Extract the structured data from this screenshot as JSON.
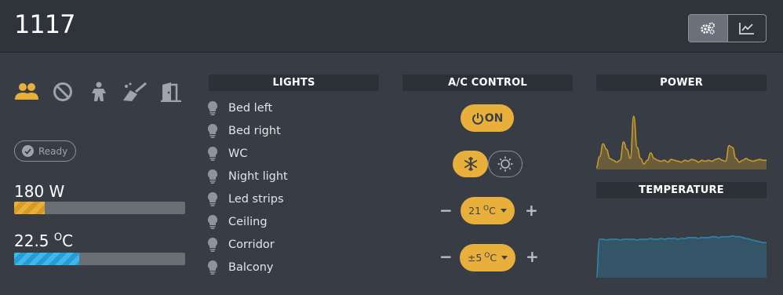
{
  "header": {
    "room": "1117",
    "view_buttons": [
      {
        "name": "settings",
        "icon": "gears-icon",
        "active": true
      },
      {
        "name": "charts",
        "icon": "line-chart-icon",
        "active": false
      }
    ]
  },
  "status": {
    "icons": [
      {
        "icon": "occupied-users-icon",
        "color": "#e8b03a"
      },
      {
        "icon": "do-not-disturb-icon",
        "color": "#9ea4ab"
      },
      {
        "icon": "person-icon",
        "color": "#9ea4ab"
      },
      {
        "icon": "cleaning-broom-icon",
        "color": "#9ea4ab"
      },
      {
        "icon": "door-icon",
        "color": "#9ea4ab"
      }
    ],
    "ready_label": "Ready"
  },
  "metrics": {
    "power": {
      "value": "180 W",
      "fraction": 0.18
    },
    "temperature": {
      "value": "22.5",
      "unit": "O",
      "unit_suffix": "C",
      "fraction": 0.38
    }
  },
  "lights": {
    "title": "LIGHTS",
    "items": [
      "Bed left",
      "Bed right",
      "WC",
      "Night light",
      "Led strips",
      "Ceiling",
      "Corridor",
      "Balcony"
    ]
  },
  "ac": {
    "title": "A/C CONTROL",
    "power_label": "ON",
    "setpoint": {
      "value": "21",
      "unit": "O",
      "unit_suffix": "C",
      "minus": "−",
      "plus": "+"
    },
    "offset": {
      "value": "±5",
      "unit": "O",
      "unit_suffix": "C",
      "minus": "−",
      "plus": "+"
    }
  },
  "charts": {
    "power_title": "POWER",
    "temperature_title": "TEMPERATURE"
  },
  "colors": {
    "accent": "#e8b03a",
    "power_bar": "#e8b03a",
    "temperature_bar": "#3fb7ea",
    "power_line": "#c99a2a",
    "temperature_line": "#2e84a8"
  },
  "chart_data": [
    {
      "type": "area",
      "name": "power",
      "x": [
        0,
        1,
        2,
        3,
        4,
        5,
        6,
        7,
        8,
        9,
        10,
        11,
        12,
        13,
        14,
        15,
        16,
        17,
        18,
        19,
        20,
        21,
        22,
        23,
        24,
        25,
        26,
        27,
        28,
        29,
        30,
        31,
        32,
        33,
        34,
        35,
        36,
        37,
        38,
        39,
        40,
        41,
        42,
        43,
        44,
        45,
        46,
        47,
        48,
        49,
        50
      ],
      "values": [
        2,
        14,
        28,
        22,
        12,
        10,
        8,
        10,
        30,
        22,
        12,
        58,
        24,
        12,
        6,
        10,
        18,
        12,
        10,
        9,
        10,
        8,
        11,
        10,
        9,
        8,
        10,
        9,
        11,
        10,
        8,
        10,
        9,
        10,
        9,
        11,
        12,
        10,
        9,
        26,
        24,
        12,
        8,
        10,
        12,
        10,
        9,
        10,
        11,
        10,
        10
      ],
      "ylim": [
        0,
        65
      ]
    },
    {
      "type": "area",
      "name": "temperature",
      "x": [
        0,
        1,
        2,
        3,
        4,
        5,
        6,
        7,
        8,
        9,
        10,
        11,
        12,
        13,
        14,
        15,
        16,
        17,
        18,
        19,
        20,
        21,
        22,
        23,
        24,
        25,
        26,
        27,
        28,
        29,
        30,
        31,
        32,
        33,
        34,
        35,
        36,
        37,
        38,
        39,
        40,
        41,
        42,
        43,
        44,
        45,
        46,
        47,
        48,
        49,
        50
      ],
      "values": [
        0,
        46,
        46,
        45,
        46,
        46,
        46,
        45,
        46,
        46,
        46,
        46,
        45,
        46,
        46,
        46,
        47,
        46,
        46,
        47,
        46,
        47,
        47,
        47,
        46,
        47,
        47,
        48,
        48,
        48,
        47,
        48,
        48,
        48,
        49,
        49,
        48,
        49,
        49,
        49,
        50,
        49,
        49,
        48,
        47,
        46,
        45,
        44,
        43,
        42,
        42
      ],
      "ylim": [
        0,
        60
      ]
    }
  ]
}
